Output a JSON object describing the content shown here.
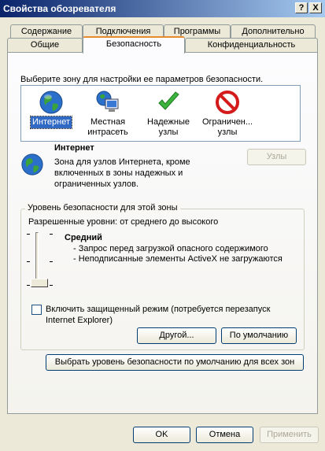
{
  "window": {
    "title": "Свойства обозревателя",
    "help_label": "?",
    "close_label": "X"
  },
  "tabs": {
    "row1": [
      "Содержание",
      "Подключения",
      "Программы",
      "Дополнительно"
    ],
    "row2": [
      "Общие",
      "Безопасность",
      "Конфиденциальность"
    ],
    "active": "Безопасность"
  },
  "zones": {
    "prompt": "Выберите зону для настройки ее параметров безопасности.",
    "items": [
      {
        "label": "Интернет",
        "icon": "globe-icon",
        "selected": true
      },
      {
        "label": "Местная интрасеть",
        "icon": "intranet-computer-icon",
        "selected": false
      },
      {
        "label": "Надежные узлы",
        "icon": "checkmark-icon",
        "selected": false
      },
      {
        "label": "Ограничен... узлы",
        "icon": "restricted-icon",
        "selected": false
      }
    ]
  },
  "zone_info": {
    "title": "Интернет",
    "description_lines": [
      "Зона для узлов Интернета, кроме",
      "включенных в зоны надежных и",
      "ограниченных узлов."
    ],
    "sites_button": "Узлы"
  },
  "security_level": {
    "group_title": "Уровень безопасности для этой зоны",
    "allowed": "Разрешенные уровни: от среднего до высокого",
    "level_name": "Средний",
    "bullets": [
      "- Запрос перед загрузкой опасного содержимого",
      "- Неподписанные элементы ActiveX не загружаются"
    ],
    "protected_mode_lines": [
      "Включить защищенный режим (потребуется перезапуск",
      "Internet Explorer)"
    ],
    "protected_mode_checked": false,
    "custom_button": "Другой...",
    "default_button": "По умолчанию"
  },
  "reset_all_button": "Выбрать уровень безопасности по умолчанию для всех зон",
  "footer": {
    "ok": "OK",
    "cancel": "Отмена",
    "apply": "Применить"
  },
  "colors": {
    "selection": "#316ac5",
    "title_start": "#0a246a",
    "title_end": "#a6caf0",
    "tab_highlight": "#e68b2c"
  }
}
